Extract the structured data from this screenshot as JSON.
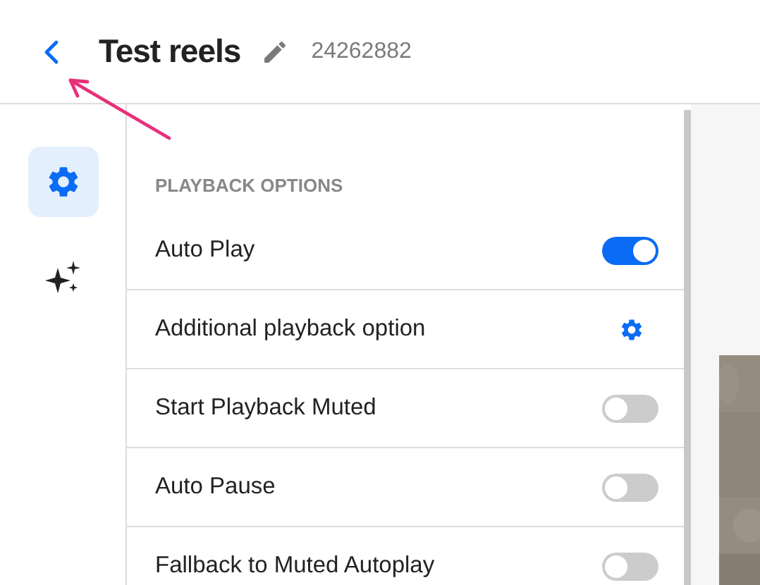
{
  "header": {
    "title": "Test reels",
    "id": "24262882"
  },
  "rail": [
    {
      "kind": "settings",
      "selected": true
    },
    {
      "kind": "effects",
      "selected": false
    }
  ],
  "section": {
    "title": "PLAYBACK OPTIONS"
  },
  "options": [
    {
      "label": "Auto Play",
      "kind": "toggle",
      "on": true
    },
    {
      "label": "Additional playback option",
      "kind": "settings"
    },
    {
      "label": "Start Playback Muted",
      "kind": "toggle",
      "on": false
    },
    {
      "label": "Auto Pause",
      "kind": "toggle",
      "on": false
    },
    {
      "label": "Fallback to Muted Autoplay",
      "kind": "toggle",
      "on": false
    }
  ]
}
